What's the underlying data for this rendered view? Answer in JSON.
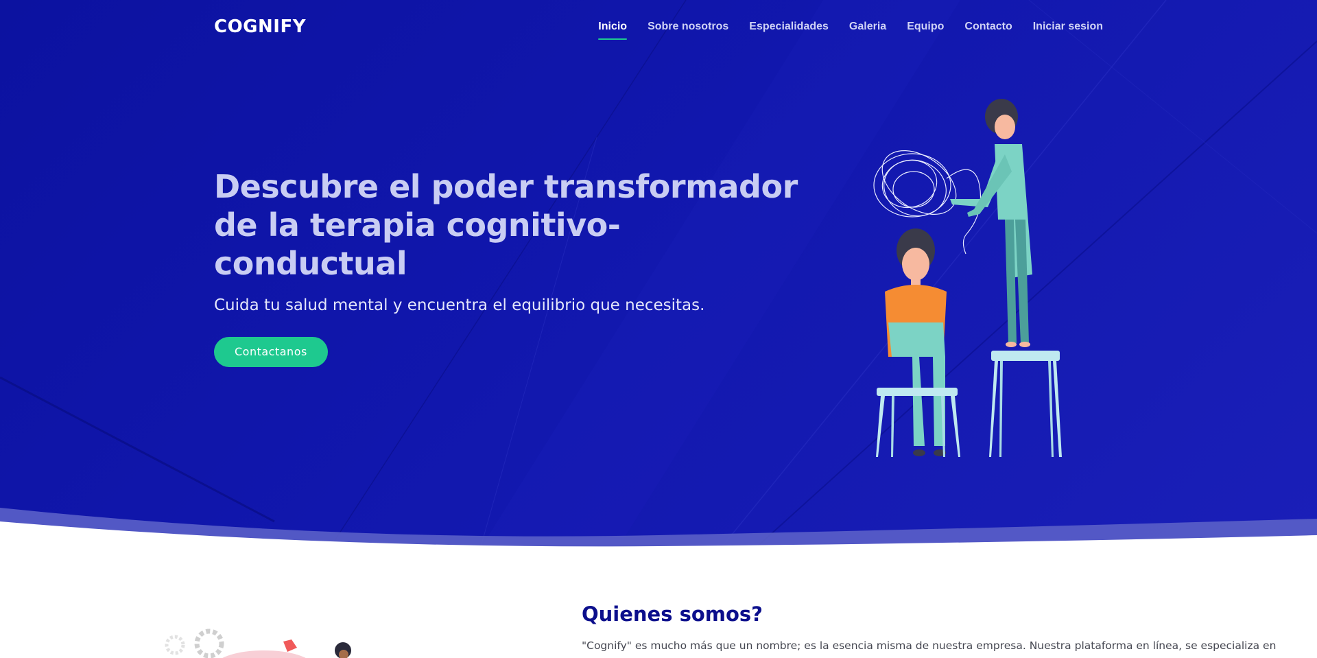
{
  "header": {
    "logo": "COGNIFY",
    "nav": [
      {
        "label": "Inicio",
        "active": true
      },
      {
        "label": "Sobre nosotros"
      },
      {
        "label": "Especialidades"
      },
      {
        "label": "Galeria"
      },
      {
        "label": "Equipo"
      },
      {
        "label": "Contacto"
      },
      {
        "label": "Iniciar sesion"
      }
    ]
  },
  "hero": {
    "title": "Descubre el poder transformador de la terapia cognitivo-conductual",
    "subtitle": "Cuida tu salud mental y encuentra el equilibrio que necesitas.",
    "cta_label": "Contactanos"
  },
  "about": {
    "title": "Quienes somos?",
    "text": "\"Cognify\" es mucho más que un nombre; es la esencia misma de nuestra empresa. Nuestra plataforma en línea, se especializa en"
  },
  "colors": {
    "hero_bg": "#1117ad",
    "accent": "#1ec98f",
    "heading_dark": "#0c0f8c"
  },
  "icons": [
    "therapy-scene-illustration",
    "gear-icon",
    "person-illustration"
  ]
}
